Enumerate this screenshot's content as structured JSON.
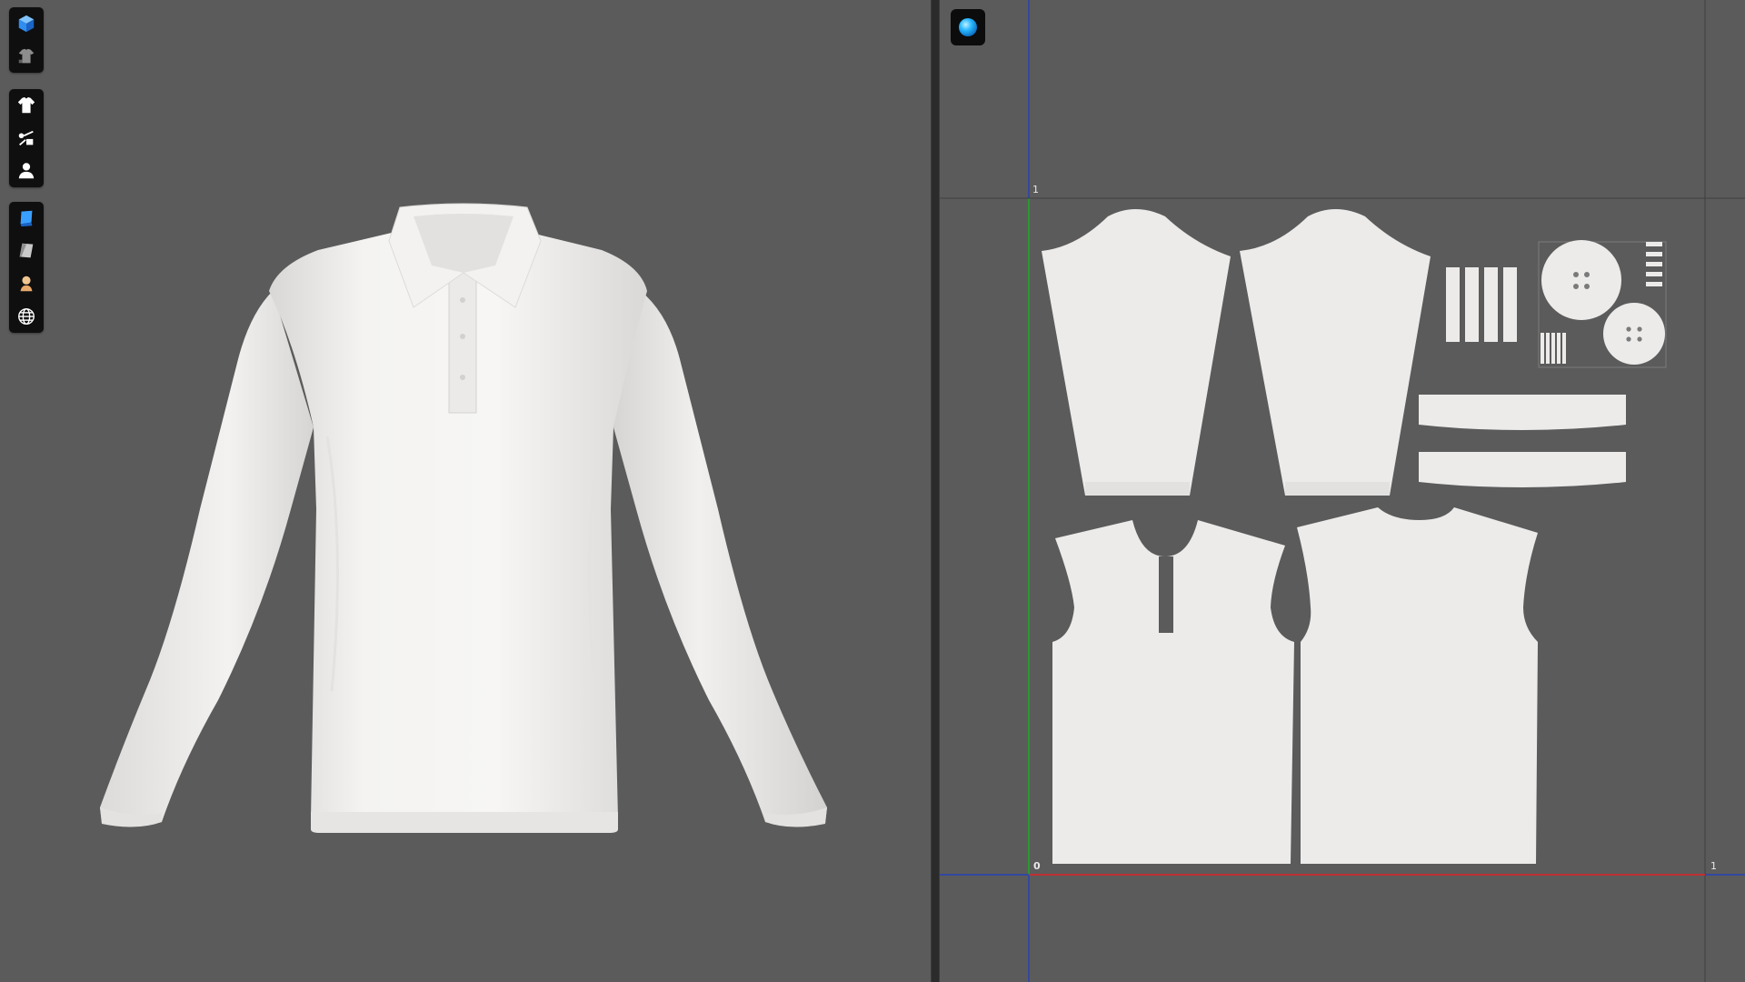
{
  "toolbar": {
    "group1": [
      {
        "icon": "cube-3d-view-icon",
        "color": "#3aa0ff"
      },
      {
        "icon": "garment-avatar-view-icon",
        "color": "#9a9a9a"
      }
    ],
    "group2": [
      {
        "icon": "shirt-icon",
        "color": "#ffffff"
      },
      {
        "icon": "hanger-trims-icon",
        "color": "#ffffff"
      },
      {
        "icon": "avatar-icon",
        "color": "#ffffff"
      }
    ],
    "group3": [
      {
        "icon": "texture-blue-icon",
        "color": "#3aa0ff"
      },
      {
        "icon": "fabric-gray-icon",
        "color": "#bdbdbd"
      },
      {
        "icon": "avatar-skin-icon",
        "color": "#f1c58f"
      },
      {
        "icon": "globe-grid-icon",
        "color": "#ffffff"
      }
    ]
  },
  "uv_editor": {
    "mode_icon": "uv-sphere-icon",
    "axis_labels": {
      "v_top": "1",
      "origin": "0",
      "u_right": "1"
    },
    "axis_colors": {
      "u_axis": "#d02a2a",
      "v_axis": "#1fb01f",
      "border": "#1e3cc8"
    }
  },
  "colors": {
    "background": "#5b5b5b",
    "panel_divider": "#2b2b2b",
    "fabric": "#ecebea"
  }
}
